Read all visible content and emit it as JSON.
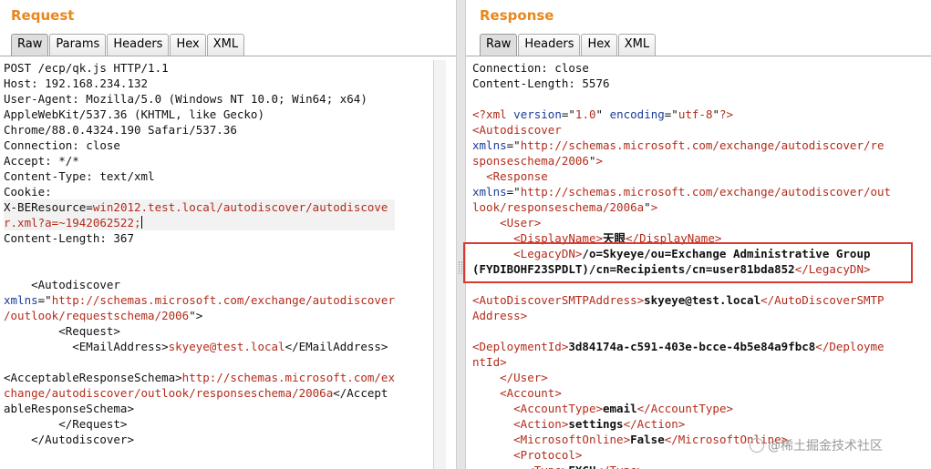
{
  "request": {
    "title": "Request",
    "tabs": [
      "Raw",
      "Params",
      "Headers",
      "Hex",
      "XML"
    ],
    "active_tab": "Raw"
  },
  "response": {
    "title": "Response",
    "tabs": [
      "Raw",
      "Headers",
      "Hex",
      "XML"
    ],
    "active_tab": "Raw"
  },
  "watermark": "@稀土掘金技术社区",
  "colors": {
    "title": "#e8871e",
    "xml_tag": "#b32c1b",
    "xml_attr": "#1b3c9a",
    "highlight_box": "#d93b33"
  }
}
